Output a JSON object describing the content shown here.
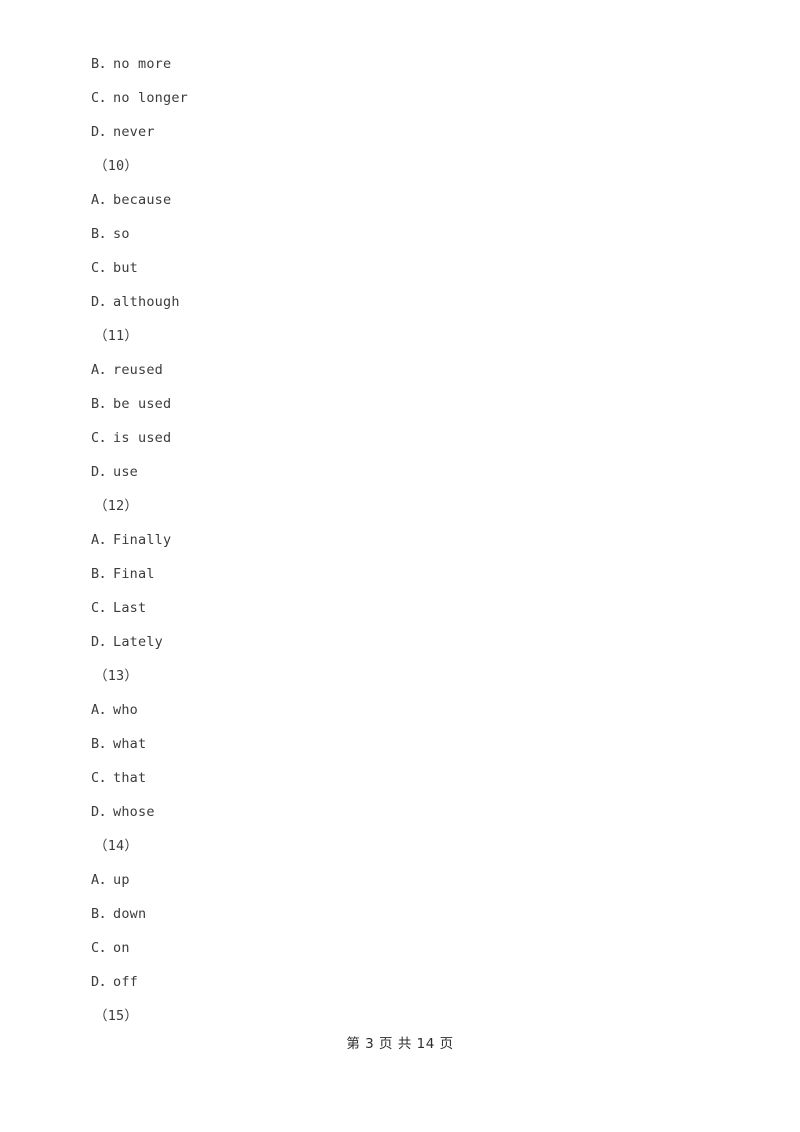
{
  "document": {
    "lines": [
      {
        "kind": "option",
        "text": "B．no more"
      },
      {
        "kind": "option",
        "text": "C．no longer"
      },
      {
        "kind": "option",
        "text": "D．never"
      },
      {
        "kind": "qlabel",
        "text": "（10）"
      },
      {
        "kind": "option",
        "text": "A．because"
      },
      {
        "kind": "option",
        "text": "B．so"
      },
      {
        "kind": "option",
        "text": "C．but"
      },
      {
        "kind": "option",
        "text": "D．although"
      },
      {
        "kind": "qlabel",
        "text": "（11）"
      },
      {
        "kind": "option",
        "text": "A．reused"
      },
      {
        "kind": "option",
        "text": "B．be used"
      },
      {
        "kind": "option",
        "text": "C．is used"
      },
      {
        "kind": "option",
        "text": "D．use"
      },
      {
        "kind": "qlabel",
        "text": "（12）"
      },
      {
        "kind": "option",
        "text": "A．Finally"
      },
      {
        "kind": "option",
        "text": "B．Final"
      },
      {
        "kind": "option",
        "text": "C．Last"
      },
      {
        "kind": "option",
        "text": "D．Lately"
      },
      {
        "kind": "qlabel",
        "text": "（13）"
      },
      {
        "kind": "option",
        "text": "A．who"
      },
      {
        "kind": "option",
        "text": "B．what"
      },
      {
        "kind": "option",
        "text": "C．that"
      },
      {
        "kind": "option",
        "text": "D．whose"
      },
      {
        "kind": "qlabel",
        "text": "（14）"
      },
      {
        "kind": "option",
        "text": "A．up"
      },
      {
        "kind": "option",
        "text": "B．down"
      },
      {
        "kind": "option",
        "text": "C．on"
      },
      {
        "kind": "option",
        "text": "D．off"
      },
      {
        "kind": "qlabel",
        "text": "（15）"
      }
    ],
    "footer": {
      "text": "第 3 页 共 14 页",
      "current_page": "3",
      "total_pages": "14"
    }
  }
}
